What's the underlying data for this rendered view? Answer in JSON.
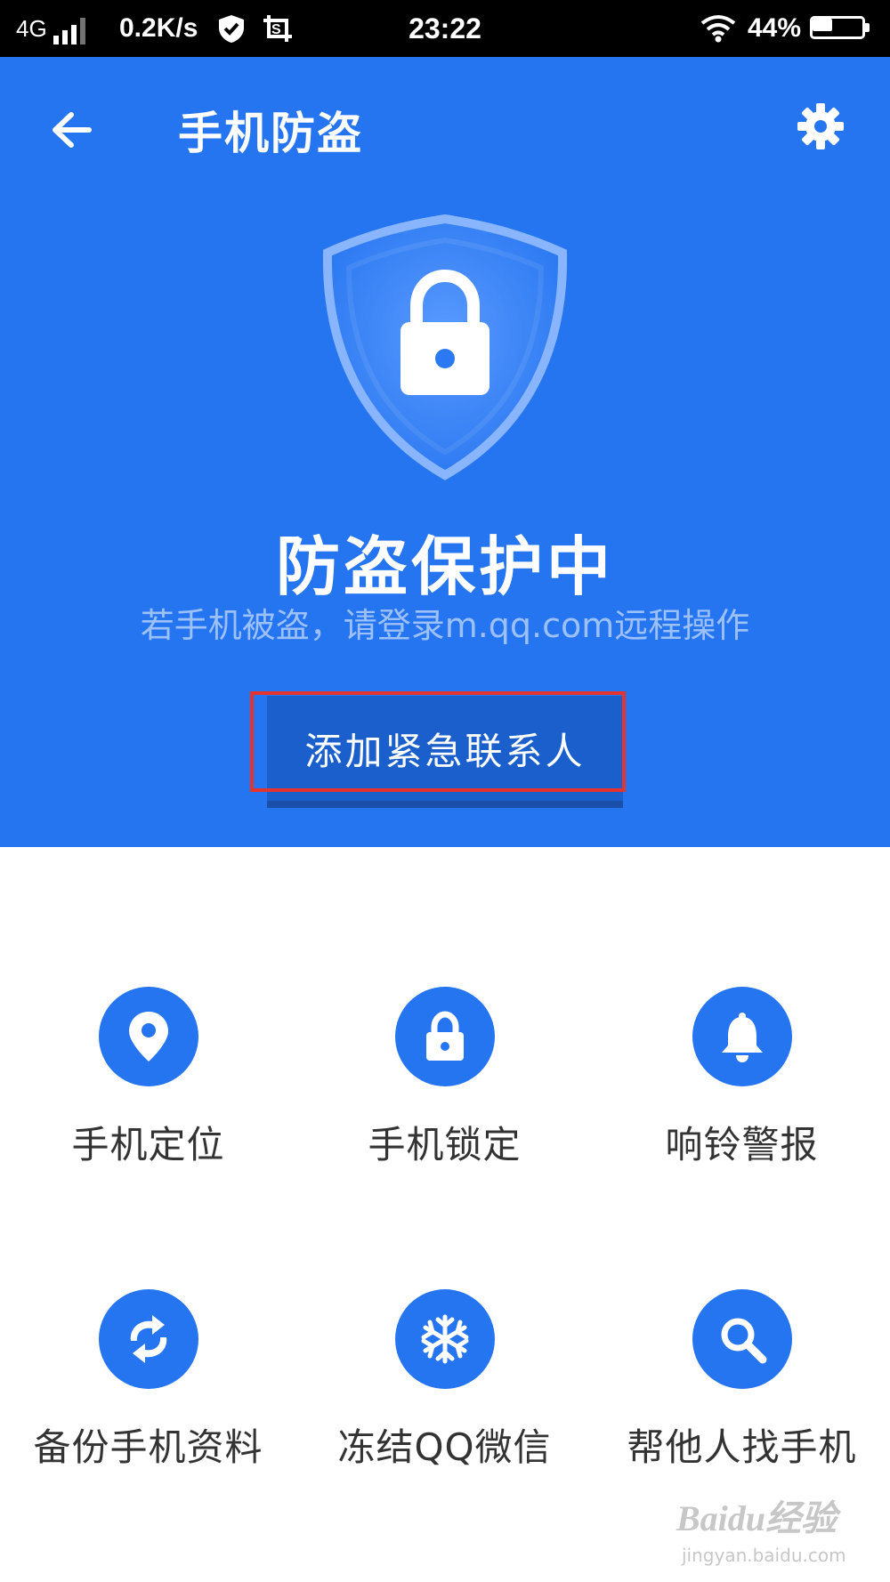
{
  "status_bar": {
    "network": "4G",
    "speed": "0.2K/s",
    "time": "23:22",
    "battery_percent": "44%",
    "battery_level": 0.44,
    "icons": [
      "signal-icon",
      "shield-check-icon",
      "screenshot-icon",
      "wifi-icon",
      "battery-icon"
    ]
  },
  "header": {
    "title": "手机防盗",
    "back_icon": "arrow-left-icon",
    "settings_icon": "gear-icon"
  },
  "hero": {
    "shield_icon": "shield-lock-icon",
    "status_title": "防盗保护中",
    "status_subtitle": "若手机被盗，请登录m.qq.com远程操作",
    "button_label": "添加紧急联系人"
  },
  "features": [
    {
      "label": "手机定位",
      "icon": "location-pin-icon"
    },
    {
      "label": "手机锁定",
      "icon": "lock-icon"
    },
    {
      "label": "响铃警报",
      "icon": "bell-icon"
    },
    {
      "label": "备份手机资料",
      "icon": "sync-icon"
    },
    {
      "label": "冻结QQ微信",
      "icon": "snowflake-icon"
    },
    {
      "label": "帮他人找手机",
      "icon": "search-icon"
    }
  ],
  "watermark": {
    "brand": "Baidu经验",
    "url": "jingyan.baidu.com"
  },
  "colors": {
    "primary": "#2574f0",
    "button": "#1b5fcc",
    "highlight": "#e5332e",
    "label_text": "#333333"
  }
}
